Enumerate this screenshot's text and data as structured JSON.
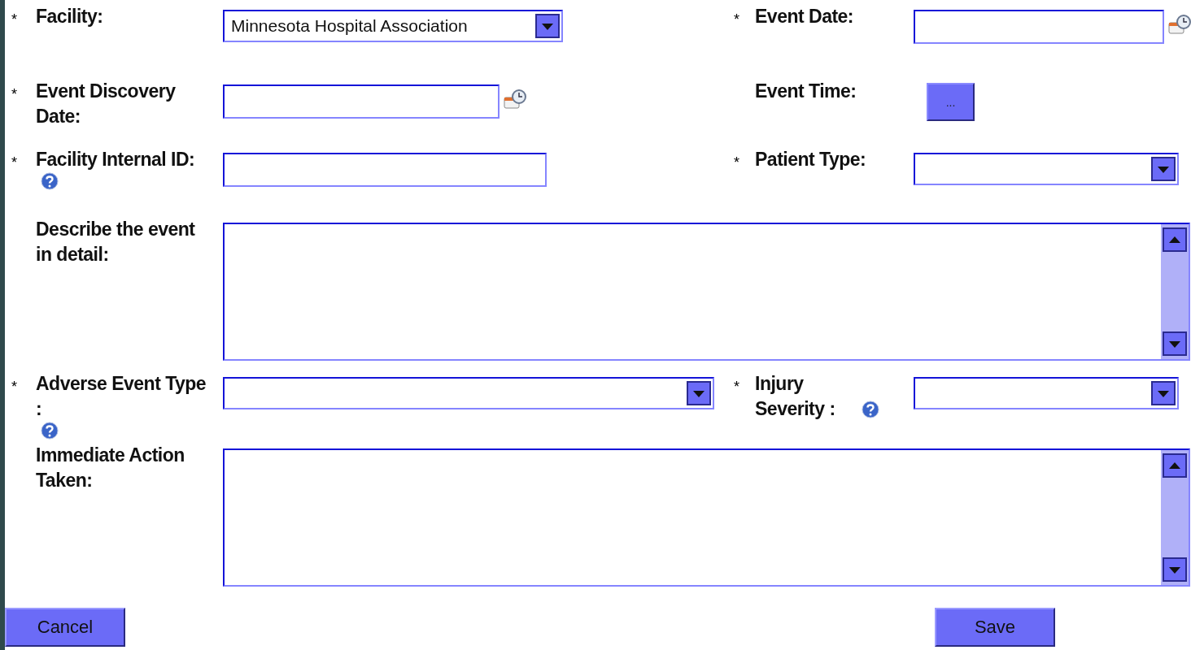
{
  "rows": [
    [
      {
        "required_mark": "*",
        "label": "Facility:",
        "kind": "select",
        "value": "Minnesota Hospital Association"
      },
      {
        "required_mark": "*",
        "label": "Event Date:",
        "kind": "date"
      }
    ],
    [
      {
        "required_mark": "*",
        "label": "Event Discovery Date:",
        "kind": "date"
      },
      {
        "label": "Event Time:",
        "kind": "button",
        "value": "..."
      }
    ],
    [
      {
        "required_mark": "*",
        "label": "Facility Internal ID:",
        "kind": "text",
        "help": true
      },
      {
        "required_mark": "*",
        "label": "Patient Type:",
        "kind": "select"
      }
    ],
    [
      {
        "label": "Describe the event in detail:",
        "kind": "textarea"
      }
    ],
    [
      {
        "required_mark": "*",
        "label": "Adverse Event Type :",
        "kind": "select",
        "help": true
      },
      {
        "required_mark": "*",
        "label": "Injury Severity :",
        "kind": "select",
        "help": true
      }
    ],
    [
      {
        "label": "Immediate Action Taken:",
        "kind": "textarea"
      }
    ]
  ],
  "buttons": [
    {
      "label": "Cancel"
    },
    {
      "label": "Save"
    }
  ]
}
